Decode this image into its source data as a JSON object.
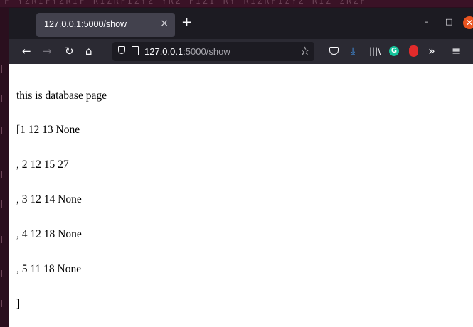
{
  "browser": {
    "tab": {
      "title": "127.0.0.1:5000/show",
      "close_glyph": "×"
    },
    "new_tab_glyph": "+",
    "window_controls": {
      "minimize": "–",
      "maximize": "□",
      "close": "✕"
    },
    "nav": {
      "back_icon": "arrow-left-icon",
      "forward_icon": "arrow-right-icon",
      "reload_icon": "reload-icon",
      "home_icon": "home-icon"
    },
    "url": {
      "host": "127.0.0.1",
      "rest": ":5000/show"
    },
    "toolbar_icons": [
      "pocket-icon",
      "download-icon",
      "library-icon",
      "grammarly-icon",
      "ublock-icon",
      "overflow-icon",
      "menu-icon"
    ],
    "colors": {
      "tabbar_bg": "#1c1b22",
      "navbar_bg": "#2b2a33",
      "active_tab": "#42414d",
      "download_accent": "#45a1ff",
      "close_button": "#e95420"
    }
  },
  "page": {
    "lines": [
      "this is database page",
      "[1 12 13 None",
      ", 2 12 15 27",
      ", 3 12 14 None",
      ", 4 12 18 None",
      ", 5 11 18 None",
      "]"
    ]
  }
}
